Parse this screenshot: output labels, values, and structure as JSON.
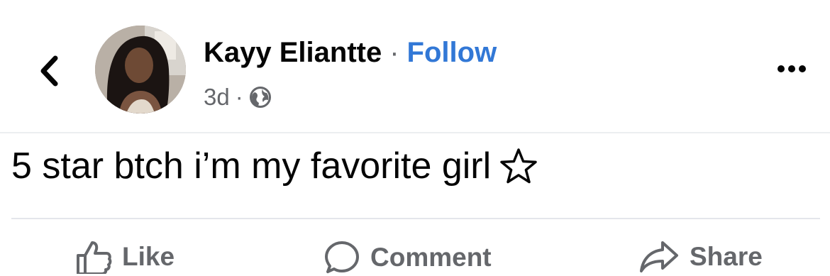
{
  "header": {
    "author_name": "Kayy Eliantte",
    "separator": "·",
    "follow_label": "Follow",
    "timestamp": "3d",
    "meta_separator": "·",
    "audience_icon": "globe-icon",
    "back_icon": "chevron-left-icon",
    "more_icon": "more-horizontal-icon"
  },
  "post": {
    "text": "5 star btch i’m my favorite girl",
    "emoji_icon": "star-outline-icon"
  },
  "actions": {
    "like_label": "Like",
    "comment_label": "Comment",
    "share_label": "Share"
  },
  "colors": {
    "link": "#3278d6",
    "secondary_text": "#65676b",
    "primary_text": "#050505"
  }
}
